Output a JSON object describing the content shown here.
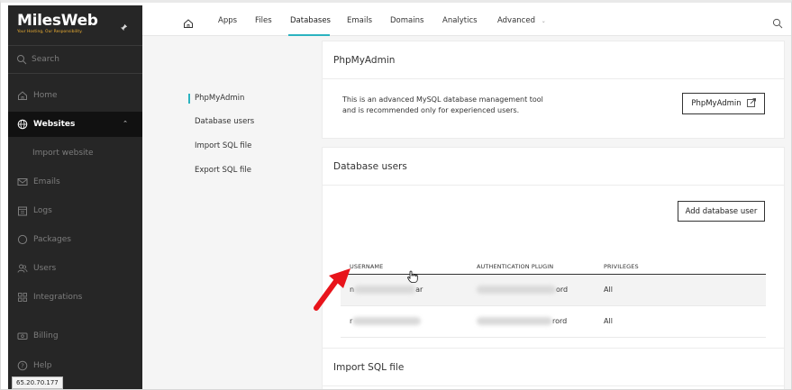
{
  "brand": {
    "name": "MilesWeb",
    "tagline": "Your Hosting, Our Responsibility."
  },
  "sidebar": {
    "search_label": "Search",
    "items": [
      {
        "label": "Home",
        "icon": "home-icon"
      },
      {
        "label": "Websites",
        "icon": "globe-icon",
        "active": true
      },
      {
        "label": "Import website",
        "icon": ""
      },
      {
        "label": "Emails",
        "icon": "mail-icon"
      },
      {
        "label": "Logs",
        "icon": "calendar-icon"
      },
      {
        "label": "Packages",
        "icon": "package-icon"
      },
      {
        "label": "Users",
        "icon": "users-icon"
      },
      {
        "label": "Integrations",
        "icon": "grid-icon"
      },
      {
        "label": "Billing",
        "icon": "billing-icon"
      },
      {
        "label": "Help",
        "icon": "help-icon"
      }
    ],
    "ip_tooltip": "65.20.70.177"
  },
  "topnav": {
    "items": [
      "Apps",
      "Files",
      "Databases",
      "Emails",
      "Domains",
      "Analytics",
      "Advanced"
    ],
    "active": "Databases"
  },
  "subnav": {
    "items": [
      "PhpMyAdmin",
      "Database users",
      "Import SQL file",
      "Export SQL file"
    ],
    "active": "PhpMyAdmin"
  },
  "phpmyadmin_card": {
    "title": "PhpMyAdmin",
    "description_line1": "This is an advanced MySQL database management tool",
    "description_line2": "and is recommended only for experienced users.",
    "button_label": "PhpMyAdmin"
  },
  "db_users_card": {
    "title": "Database users",
    "add_button_label": "Add database user",
    "columns": [
      "USERNAME",
      "AUTHENTICATION PLUGIN",
      "PRIVILEGES"
    ],
    "rows": [
      {
        "username_prefix": "n",
        "username_suffix": "ar",
        "plugin_suffix": "ord",
        "privileges": "All"
      },
      {
        "username_prefix": "r",
        "username_suffix": "",
        "plugin_suffix": "rord",
        "privileges": "All"
      }
    ]
  },
  "import_card": {
    "title": "Import SQL file"
  },
  "colors": {
    "accent": "#2bb3c0",
    "sidebar_bg": "#262626",
    "arrow": "#e8141b",
    "brand_tagline": "#f2b233"
  }
}
